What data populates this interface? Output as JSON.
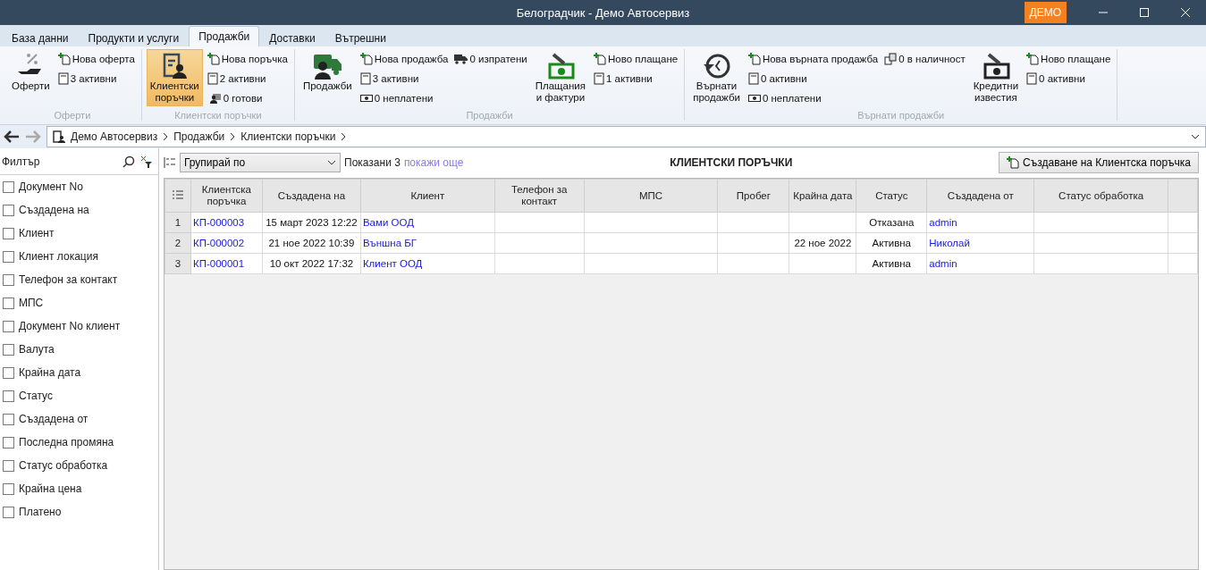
{
  "window": {
    "title": "Белоградчик - Демо Автосервиз",
    "badge": "ДЕМО"
  },
  "tabs": [
    {
      "label": "База данни",
      "selected": false
    },
    {
      "label": "Продукти и услуги",
      "selected": false
    },
    {
      "label": "Продажби",
      "selected": true
    },
    {
      "label": "Доставки",
      "selected": false
    },
    {
      "label": "Вътрешни",
      "selected": false
    }
  ],
  "ribbon": [
    {
      "label": "Оферти",
      "sections": [
        {
          "kind": "large",
          "label": "Оферти",
          "selected": false
        },
        {
          "kind": "column",
          "items": [
            {
              "kind": "new",
              "label": "Нова оферта"
            },
            {
              "kind": "list",
              "label": "3 активни"
            }
          ]
        }
      ]
    },
    {
      "label": "Клиентски поръчки",
      "sections": [
        {
          "kind": "large",
          "label": "Клиентски\nпоръчки",
          "selected": true
        },
        {
          "kind": "column",
          "items": [
            {
              "kind": "new",
              "label": "Нова поръчка"
            },
            {
              "kind": "list",
              "label": "2 активни"
            },
            {
              "kind": "ready",
              "label": "0 готови"
            }
          ]
        }
      ]
    },
    {
      "label": "Продажби",
      "sections": [
        {
          "kind": "large",
          "label": "Продажби",
          "selected": false
        },
        {
          "kind": "column",
          "items": [
            {
              "kind": "new",
              "label": "Нова продажба"
            },
            {
              "kind": "list",
              "label": "3 активни"
            },
            {
              "kind": "money",
              "label": "0 неплатени"
            }
          ]
        },
        {
          "kind": "column",
          "items": [
            {
              "kind": "truck",
              "label": "0 изпратени"
            }
          ]
        },
        {
          "kind": "large",
          "label": "Плащания\nи фактури",
          "selected": false
        },
        {
          "kind": "column",
          "items": [
            {
              "kind": "new",
              "label": "Ново плащане"
            },
            {
              "kind": "list",
              "label": "1 активни"
            }
          ]
        }
      ]
    },
    {
      "label": "Върнати продажби",
      "sections": [
        {
          "kind": "large",
          "label": "Върнати\nпродажби",
          "selected": false
        },
        {
          "kind": "column",
          "items": [
            {
              "kind": "new",
              "label": "Нова върната продажба"
            },
            {
              "kind": "list",
              "label": "0 активни"
            },
            {
              "kind": "money",
              "label": "0 неплатени"
            }
          ]
        },
        {
          "kind": "column",
          "items": [
            {
              "kind": "stock",
              "label": "0 в наличност"
            }
          ]
        },
        {
          "kind": "large",
          "label": "Кредитни\nизвестия",
          "selected": false
        },
        {
          "kind": "column",
          "items": [
            {
              "kind": "new",
              "label": "Ново плащане"
            },
            {
              "kind": "list",
              "label": "0 активни"
            }
          ]
        }
      ]
    }
  ],
  "breadcrumb": [
    "Демо Автосервиз",
    "Продажби",
    "Клиентски поръчки"
  ],
  "filter": {
    "title": "Филтър",
    "items": [
      {
        "label": "Документ No",
        "checked": false
      },
      {
        "label": "Създадена на",
        "checked": false
      },
      {
        "label": "Клиент",
        "checked": false
      },
      {
        "label": "Клиент локация",
        "checked": false
      },
      {
        "label": "Телефон за контакт",
        "checked": false
      },
      {
        "label": "МПС",
        "checked": false
      },
      {
        "label": "Документ No клиент",
        "checked": false
      },
      {
        "label": "Валута",
        "checked": false
      },
      {
        "label": "Крайна дата",
        "checked": false
      },
      {
        "label": "Статус",
        "checked": false
      },
      {
        "label": "Създадена от",
        "checked": false
      },
      {
        "label": "Последна промяна",
        "checked": false
      },
      {
        "label": "Статус обработка",
        "checked": false
      },
      {
        "label": "Крайна цена",
        "checked": false
      },
      {
        "label": "Платено",
        "checked": false
      }
    ]
  },
  "toolbar": {
    "group_by": "Групирай по",
    "shown": "Показани 3",
    "show_more": "покажи още",
    "title": "КЛИЕНТСКИ ПОРЪЧКИ",
    "create_button": "Създаване на Клиентска поръчка"
  },
  "table": {
    "columns": [
      "Клиентска поръчка",
      "Създадена на",
      "Клиент",
      "Телефон за контакт",
      "МПС",
      "Пробег",
      "Крайна дата",
      "Статус",
      "Създадена от",
      "Статус обработка"
    ],
    "rows": [
      {
        "number": "1",
        "cells": [
          {
            "text": "КП-000003",
            "link": true
          },
          {
            "text": "15 март 2023 12:22",
            "link": false
          },
          {
            "text": "Вами ООД",
            "link": true
          },
          "",
          "",
          "",
          "",
          {
            "text": "Отказана",
            "link": false
          },
          {
            "text": "admin",
            "link": true
          },
          ""
        ]
      },
      {
        "number": "2",
        "cells": [
          {
            "text": "КП-000002",
            "link": true
          },
          {
            "text": "21 ное 2022 10:39",
            "link": false
          },
          {
            "text": "Външна БГ",
            "link": true
          },
          "",
          "",
          "",
          {
            "text": "22 ное 2022",
            "link": false
          },
          {
            "text": "Активна",
            "link": false
          },
          {
            "text": "Николай",
            "link": true
          },
          ""
        ]
      },
      {
        "number": "3",
        "cells": [
          {
            "text": "КП-000001",
            "link": true
          },
          {
            "text": "10 окт 2022 17:32",
            "link": false
          },
          {
            "text": "Клиент ООД",
            "link": true
          },
          "",
          "",
          "",
          "",
          {
            "text": "Активна",
            "link": false
          },
          {
            "text": "admin",
            "link": true
          },
          ""
        ]
      }
    ]
  }
}
